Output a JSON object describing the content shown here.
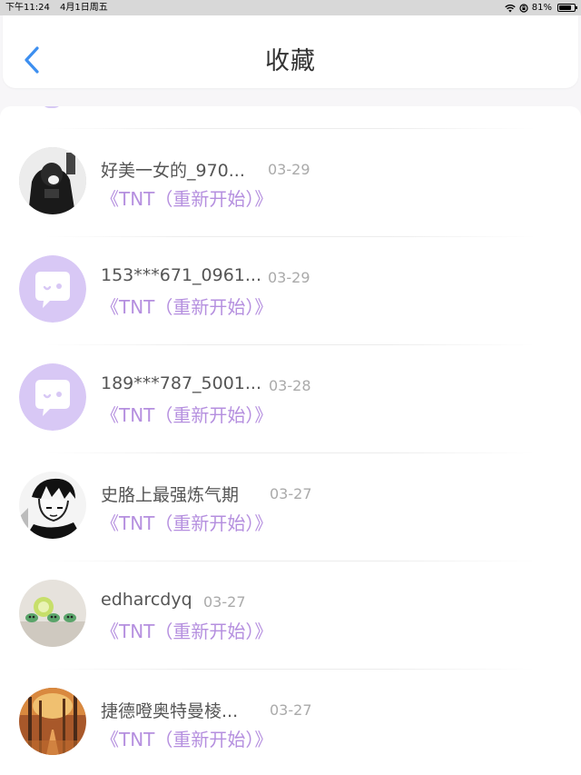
{
  "status_bar": {
    "time": "下午11:24",
    "date": "4月1日周五",
    "battery": "81%",
    "battery_level": 0.81
  },
  "header": {
    "back_icon": "chevron-left-icon",
    "title": "收藏",
    "accent_color": "#3d8ff0"
  },
  "colors": {
    "work_title": "#b58fdf",
    "default_avatar_bg": "#d8c8f5"
  },
  "favorites": [
    {
      "name": "好美一女的_970...",
      "date": "03-29",
      "work": "《TNT（重新开始）》",
      "avatar": "photo-avatar-dark-girl"
    },
    {
      "name": "153***671_0961...",
      "date": "03-29",
      "work": "《TNT（重新开始）》",
      "avatar": "default-chat-avatar-icon"
    },
    {
      "name": "189***787_5001...",
      "date": "03-28",
      "work": "《TNT（重新开始）》",
      "avatar": "default-chat-avatar-icon"
    },
    {
      "name": "史胳上最强炼气期",
      "date": "03-27",
      "work": "《TNT（重新开始）》",
      "avatar": "manga-avatar-boy"
    },
    {
      "name": "edharcdyq",
      "date": "03-27",
      "work": "《TNT（重新开始）》",
      "avatar": "photo-avatar-figurines"
    },
    {
      "name": "捷德噔奥特曼棱...",
      "date": "03-27",
      "work": "《TNT（重新开始）》",
      "avatar": "photo-avatar-autumn-forest"
    }
  ]
}
